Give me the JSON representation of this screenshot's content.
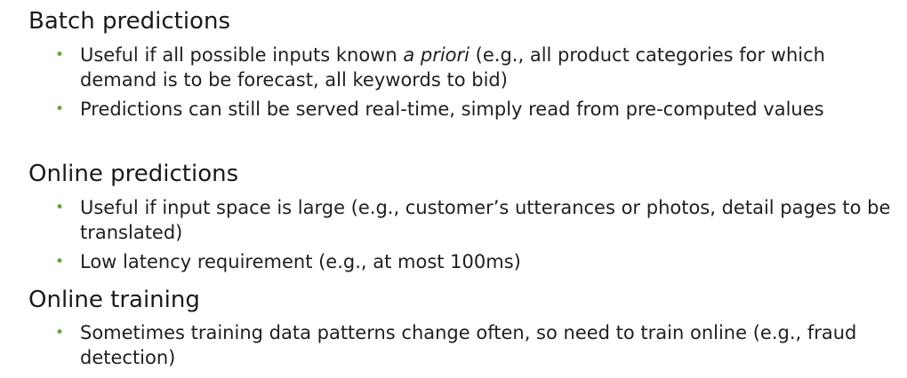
{
  "sections": [
    {
      "title": "Batch predictions",
      "bullets": [
        {
          "before": "Useful if all possible inputs known ",
          "emphasis": "a priori",
          "after": " (e.g., all product categories for which demand is to be forecast, all keywords to bid)"
        },
        {
          "text": "Predictions can still be served real-time, simply read from pre-computed values"
        }
      ]
    },
    {
      "title": "Online predictions",
      "bullets": [
        {
          "text": "Useful if input space is large (e.g., customer’s utterances or photos, detail pages to be translated)"
        },
        {
          "text": "Low latency requirement (e.g., at most 100ms)"
        }
      ]
    },
    {
      "title": "Online training",
      "bullets": [
        {
          "text": "Sometimes training data patterns change often, so need to train online (e.g., fraud detection)"
        }
      ]
    }
  ],
  "bullet_symbol": "•",
  "colors": {
    "bullet": "#5fa83a",
    "text": "#1a1a1a",
    "background": "#ffffff"
  }
}
